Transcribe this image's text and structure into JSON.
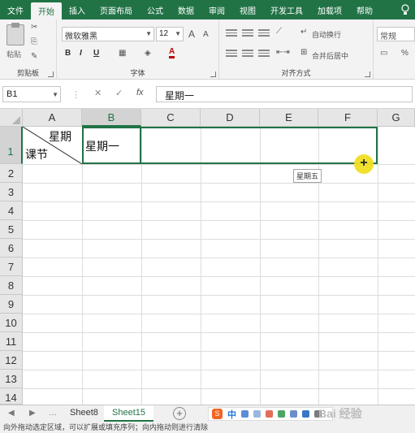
{
  "ribbon_tabs": [
    "文件",
    "开始",
    "插入",
    "页面布局",
    "公式",
    "数据",
    "审阅",
    "视图",
    "开发工具",
    "加载项",
    "帮助"
  ],
  "active_tab_index": 1,
  "ribbon": {
    "clipboard": {
      "paste_label": "粘贴",
      "group_label": "剪贴板"
    },
    "font": {
      "font_name": "微软雅黑",
      "font_size": "12",
      "grow_label": "A",
      "shrink_label": "A",
      "bold": "B",
      "italic": "I",
      "underline": "U",
      "font_color": "A",
      "group_label": "字体"
    },
    "alignment": {
      "wrap_text": "自动换行",
      "merge_center": "合并后居中",
      "group_label": "对齐方式"
    },
    "number": {
      "format": "常规",
      "percent": "%"
    }
  },
  "formula_bar": {
    "name_box": "B1",
    "cancel_icon": "✕",
    "enter_icon": "✓",
    "fx_label": "fx",
    "value": "星期一"
  },
  "columns": [
    "A",
    "B",
    "C",
    "D",
    "E",
    "F",
    "G"
  ],
  "rows": [
    "1",
    "2",
    "3",
    "4",
    "5",
    "6",
    "7",
    "8",
    "9",
    "10",
    "11",
    "12",
    "13",
    "14"
  ],
  "selected_column": "B",
  "selected_row": "1",
  "cells": {
    "A1_top": "星期",
    "A1_bottom": "课节",
    "B1": "星期一"
  },
  "fill_tooltip": "星期五",
  "sheets": [
    "Sheet8",
    "Sheet15"
  ],
  "active_sheet": "Sheet15",
  "ime": {
    "logo": "S",
    "mode": "中"
  },
  "watermark": "Bai 经验",
  "status_text": "向外拖动选定区域，可以扩展或填充序列；向内拖动则进行清除",
  "colors": {
    "accent": "#217346",
    "highlight": "#f2df23"
  }
}
